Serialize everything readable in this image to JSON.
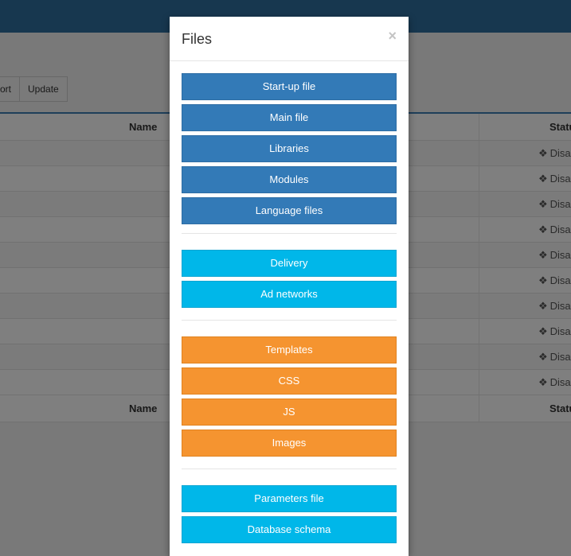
{
  "toolbar": {
    "buttons": [
      "ort",
      "Update"
    ]
  },
  "table": {
    "header_name": "Name",
    "header_status": "Statu",
    "footer_name": "Name",
    "footer_status": "Statu",
    "rows": [
      "Disa",
      "Disa",
      "Disa",
      "Disa",
      "Disa",
      "Disa",
      "Disa",
      "Disa",
      "Disa",
      "Disa"
    ]
  },
  "modal": {
    "title": "Files",
    "close": "×",
    "groups": [
      {
        "color": "blue",
        "buttons": [
          "Start-up file",
          "Main file",
          "Libraries",
          "Modules",
          "Language files"
        ]
      },
      {
        "color": "cyan",
        "buttons": [
          "Delivery",
          "Ad networks"
        ]
      },
      {
        "color": "orange",
        "buttons": [
          "Templates",
          "CSS",
          "JS",
          "Images"
        ]
      },
      {
        "color": "cyan",
        "buttons": [
          "Parameters file",
          "Database schema"
        ]
      }
    ]
  },
  "icons": {
    "status": "cubes-icon"
  }
}
